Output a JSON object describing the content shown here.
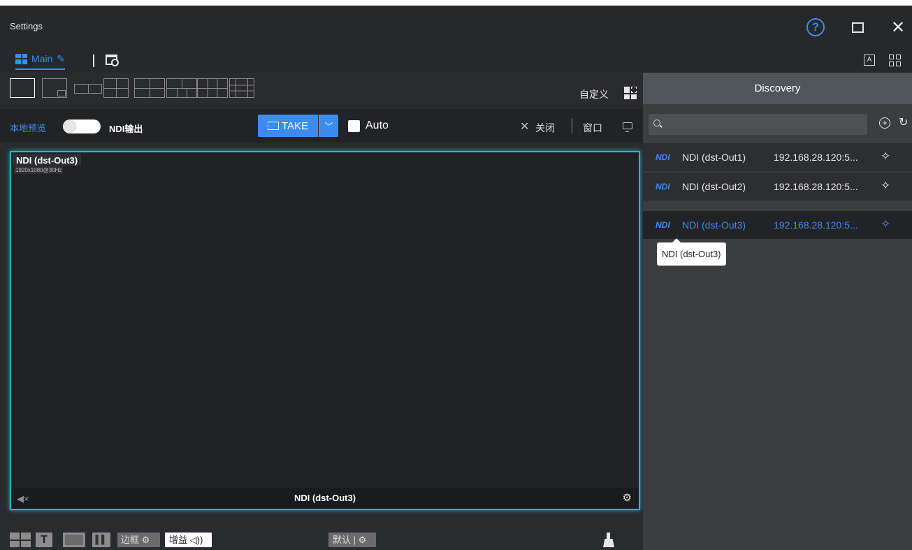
{
  "window": {
    "title": "Settings"
  },
  "tabs": {
    "main_label": "Main"
  },
  "layout_toolbar": {
    "custom_label": "自定义"
  },
  "controls": {
    "local_preview_label": "本地预览",
    "ndi_output_label": "NDI输出",
    "take_label": "TAKE",
    "auto_label": "Auto",
    "close_label": "关闭",
    "window_label": "窗口"
  },
  "preview": {
    "source_name": "NDI (dst-Out3)",
    "resolution": "1920x1080@30Hz",
    "bottom_name": "NDI (dst-Out3)"
  },
  "bottom_toolbar": {
    "border_label": "边框",
    "gain_label": "增益",
    "default_label": "默认"
  },
  "discovery": {
    "title": "Discovery",
    "search_placeholder": "",
    "items": [
      {
        "tag": "NDI",
        "name": "NDI (dst-Out1)",
        "ip": "192.168.28.120:5...",
        "selected": false
      },
      {
        "tag": "NDI",
        "name": "NDI (dst-Out2)",
        "ip": "192.168.28.120:5...",
        "selected": false
      },
      {
        "tag": "NDI",
        "name": "NDI (dst-Out3)",
        "ip": "192.168.28.120:5...",
        "selected": true
      }
    ],
    "tooltip": "NDI (dst-Out3)"
  },
  "colors": {
    "accent": "#3c8cf0",
    "preview_border": "#2bb5c4",
    "background": "#2a2b2e",
    "panel_header": "#50555c"
  }
}
